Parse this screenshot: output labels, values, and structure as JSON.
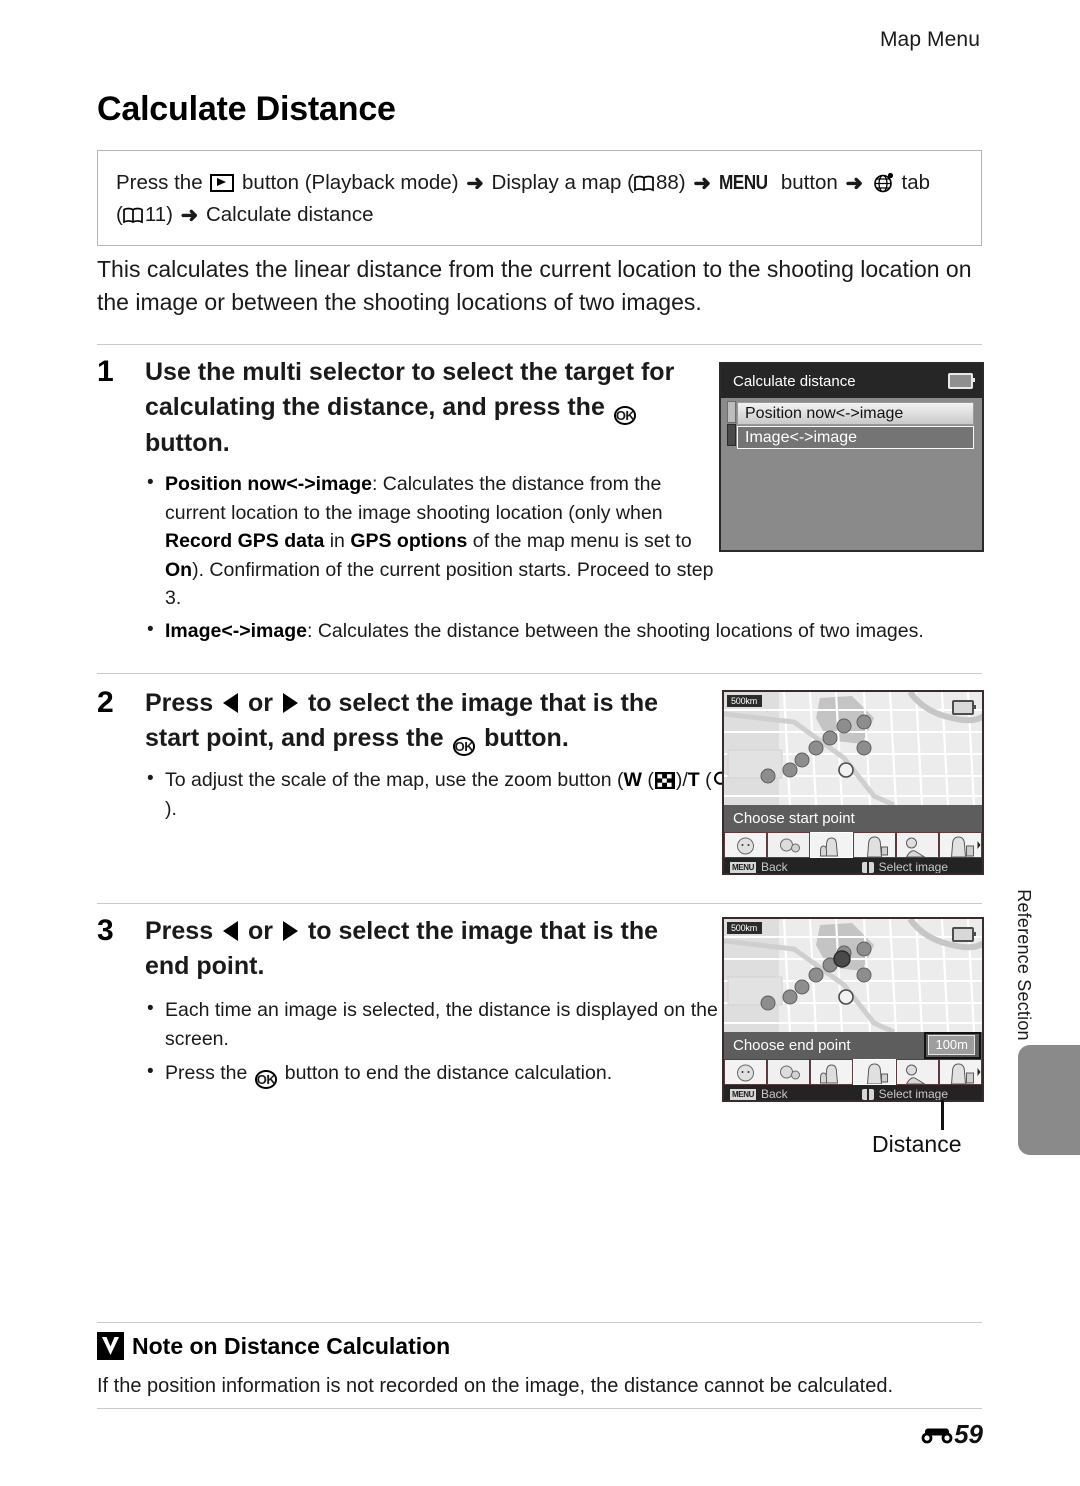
{
  "header": {
    "running_head": "Map Menu"
  },
  "title": "Calculate Distance",
  "nav_path": {
    "press_the": "Press the",
    "button_playback": "button (Playback mode)",
    "display_map": "Display a map (",
    "page_ref_88": "88)",
    "menu_label": "MENU",
    "button_word": "button",
    "tab_word": "tab",
    "page_ref_11_open": "(",
    "page_ref_11": "11)",
    "calculate_distance": "Calculate distance"
  },
  "intro": "This calculates the linear distance from the current location to the shooting location on the image or between the shooting locations of two images.",
  "steps": [
    {
      "number": "1",
      "head_a": "Use the multi selector to select the target for calculating the distance, and press the",
      "head_b": "button.",
      "bullets": [
        {
          "term": "Position now<->image",
          "text_a": ": Calculates the distance from the current location to the image shooting location (only when ",
          "bold_1": "Record GPS data",
          "text_b": " in ",
          "bold_2": "GPS options",
          "text_c": " of the map menu is set to ",
          "bold_3": "On",
          "text_d": "). Confirmation of the current position starts. Proceed to step 3."
        },
        {
          "term": "Image<->image",
          "text_a": ": Calculates the distance between the shooting locations of two images."
        }
      ]
    },
    {
      "number": "2",
      "head_a": "Press",
      "head_or": "or",
      "head_b": "to select the image that is the start point, and press the",
      "head_c": "button.",
      "bullets": [
        {
          "text_a": "To adjust the scale of the map, use the zoom button (",
          "w_label": "W",
          "slash": ")/",
          "t_label": "T",
          "text_b": ")."
        }
      ]
    },
    {
      "number": "3",
      "head_a": "Press",
      "head_or": "or",
      "head_b": "to select the image that is the end point.",
      "bullets": [
        {
          "text_a": "Each time an image is selected, the distance is displayed on the screen."
        },
        {
          "text_a": "Press the",
          "text_b": "button to end the distance calculation."
        }
      ]
    }
  ],
  "screens": {
    "menu_screen": {
      "title": "Calculate distance",
      "items": [
        {
          "label": "Position now<->image",
          "state": "highlighted"
        },
        {
          "label": "Image<->image",
          "state": "selected"
        }
      ]
    },
    "map_start": {
      "scale": "500km",
      "caption": "Choose start point",
      "back_chip": "MENU",
      "back_label": "Back",
      "select_label": "Select image"
    },
    "map_end": {
      "scale": "500km",
      "caption": "Choose end point",
      "distance_value": "100m",
      "back_chip": "MENU",
      "back_label": "Back",
      "select_label": "Select image"
    }
  },
  "callout": {
    "label": "Distance"
  },
  "side_tab": {
    "label": "Reference Section"
  },
  "note": {
    "title": "Note on Distance Calculation",
    "body": "If the position information is not recorded on the image, the distance cannot be calculated."
  },
  "footer": {
    "page": "59"
  },
  "colors": {
    "rule": "#c9c9c9",
    "screen_bezel": "#2a2a2a",
    "menu_bg": "#8a8a8a",
    "tab_gray": "#8a8a8a"
  }
}
